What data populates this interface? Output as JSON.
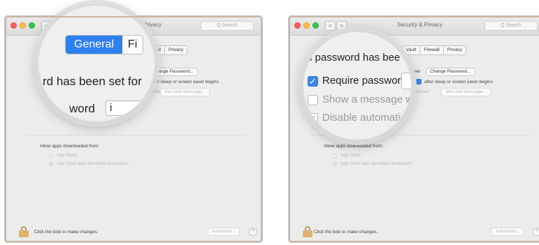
{
  "window": {
    "left_title": "Privacy",
    "right_title": "Security & Privacy",
    "nav_back": "<",
    "nav_forward": ">",
    "search_placeholder": "Q Search"
  },
  "left_panel": {
    "tabs": [
      "rewall",
      "Privacy"
    ],
    "change_password": "Change Password...",
    "after_sleep": "after sleep or screen saver begins",
    "locked_fragment": "locked",
    "set_lock_message": "Set Lock Message...",
    "allow_heading": "Allow apps downloaded from:",
    "radio_app_store": "App Store",
    "radio_identified": "App Store and identified developers",
    "lock_text": "Click the lock to make changes.",
    "advanced": "Advanced...",
    "help": "?"
  },
  "left_magnifier": {
    "tab_general": "General",
    "tab_file_fragment": "Fi",
    "message": "rd has been set for",
    "password_fragment": "word",
    "field_fragment": "i"
  },
  "right_panel": {
    "tabs": [
      "Vault",
      "Firewall",
      "Privacy"
    ],
    "user_fragment": "user",
    "change_password": "Change Password...",
    "after_sleep": "after sleep or screen saver begins",
    "locked_fragment": "n is locked",
    "set_lock_message": "Set Lock Message...",
    "allow_heading": "Allow apps downloaded from:",
    "radio_app_store": "App Store",
    "radio_identified": "App Store and identified developers",
    "lock_text": "Click the lock to make changes.",
    "advanced": "Advanced...",
    "help": "?"
  },
  "right_magnifier": {
    "message": "n password has bee",
    "require_password": "Require password",
    "show_message": "Show a message wh",
    "disable_automatic": "Disable automatic l",
    "require_checked": "✓",
    "disable_checked": "✓"
  },
  "colors": {
    "accent": "#2e7ff0",
    "lock": "#e0b36b",
    "panel_border": "#c9b5a5"
  }
}
